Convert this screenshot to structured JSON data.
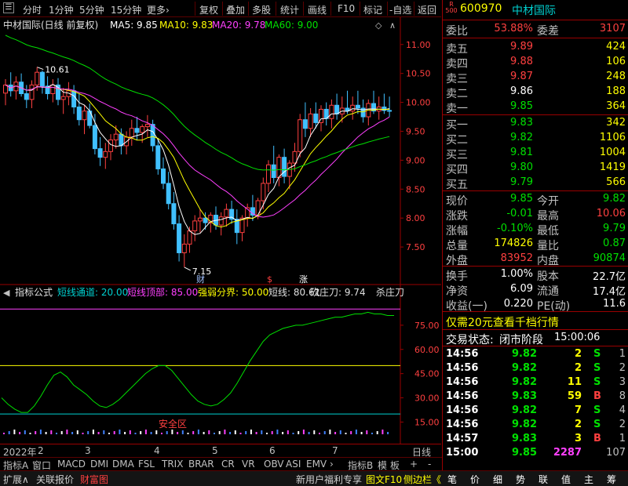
{
  "toolbar": {
    "items": [
      "分时",
      "1分钟",
      "5分钟",
      "15分钟",
      "更多›",
      "复权",
      "叠加",
      "多股",
      "统计",
      "画线",
      "F10",
      "标记",
      "-自选",
      "返回"
    ]
  },
  "chart": {
    "stock_title": "中材国际(日线 前复权)",
    "ma5": "MA5: 9.85",
    "ma10": "MA10: 9.83",
    "ma20": "MA20: 9.78",
    "ma60": "MA60: 9.00",
    "colors": {
      "up": "#ff4040",
      "down": "#40c0ff",
      "ma5": "#ffffff",
      "ma10": "#ffff00",
      "ma20": "#ff40ff",
      "ma60": "#00e000"
    },
    "y_ticks": [
      "11.00",
      "10.50",
      "10.00",
      "9.50",
      "9.00",
      "8.50",
      "8.00",
      "7.50"
    ],
    "high_label": "10.61",
    "low_label": "7.15",
    "markers": [
      "财",
      "$",
      "涨"
    ],
    "ind_bar": [
      "指标公式",
      "短线通道: 20.00",
      "短线顶部: 85.00",
      "强弱分界: 50.00",
      "短线: 80.61",
      "砍庄刀: 9.74",
      "杀庄刀"
    ],
    "ind_ticks": [
      "75.00",
      "60.00",
      "45.00",
      "30.00",
      "15.00"
    ],
    "safe_zone": "安全区",
    "date_labels": [
      "2022年",
      "2",
      "3",
      "4",
      "5",
      "6",
      "7"
    ],
    "period": "日线"
  },
  "chart_data": {
    "type": "candlestick",
    "ylim": [
      7.0,
      11.2
    ],
    "days": [
      [
        10.16,
        10.4,
        9.95,
        10.3
      ],
      [
        10.3,
        10.52,
        10.1,
        10.2
      ],
      [
        10.2,
        10.45,
        10.05,
        10.35
      ],
      [
        10.35,
        10.5,
        10.1,
        10.15
      ],
      [
        10.15,
        10.3,
        9.9,
        10.05
      ],
      [
        10.05,
        10.38,
        9.9,
        10.3
      ],
      [
        10.3,
        10.61,
        10.2,
        10.52
      ],
      [
        10.52,
        10.55,
        10.15,
        10.28
      ],
      [
        10.28,
        10.45,
        10.05,
        10.15
      ],
      [
        10.15,
        10.4,
        10.0,
        10.3
      ],
      [
        10.3,
        10.42,
        9.95,
        10.05
      ],
      [
        10.05,
        10.25,
        9.8,
        10.1
      ],
      [
        10.1,
        10.35,
        9.95,
        10.2
      ],
      [
        10.2,
        10.3,
        9.8,
        9.92
      ],
      [
        9.92,
        10.15,
        9.6,
        9.7
      ],
      [
        9.7,
        9.95,
        9.45,
        9.85
      ],
      [
        9.85,
        9.98,
        9.55,
        9.6
      ],
      [
        9.6,
        9.8,
        9.1,
        9.2
      ],
      [
        9.2,
        9.4,
        8.9,
        9.05
      ],
      [
        9.05,
        9.3,
        8.85,
        9.15
      ],
      [
        9.15,
        9.45,
        9.0,
        9.35
      ],
      [
        9.35,
        9.6,
        9.2,
        9.45
      ],
      [
        9.45,
        9.55,
        9.1,
        9.25
      ],
      [
        9.25,
        9.5,
        9.1,
        9.4
      ],
      [
        9.4,
        9.7,
        9.25,
        9.55
      ],
      [
        9.55,
        9.75,
        9.35,
        9.48
      ],
      [
        9.48,
        9.62,
        9.3,
        9.58
      ],
      [
        9.58,
        9.78,
        9.4,
        9.62
      ],
      [
        9.62,
        9.7,
        9.15,
        9.25
      ],
      [
        9.25,
        9.38,
        8.75,
        8.85
      ],
      [
        8.85,
        9.05,
        8.5,
        8.6
      ],
      [
        8.6,
        8.8,
        8.15,
        8.25
      ],
      [
        8.25,
        8.45,
        7.8,
        7.9
      ],
      [
        7.9,
        8.05,
        7.25,
        7.4
      ],
      [
        7.4,
        7.72,
        7.15,
        7.55
      ],
      [
        7.55,
        7.85,
        7.4,
        7.78
      ],
      [
        7.78,
        8.05,
        7.6,
        7.95
      ],
      [
        7.95,
        8.15,
        7.75,
        8.0
      ],
      [
        8.0,
        8.1,
        7.8,
        7.92
      ],
      [
        7.92,
        8.1,
        7.75,
        8.05
      ],
      [
        8.05,
        8.2,
        7.8,
        7.88
      ],
      [
        7.88,
        8.1,
        7.7,
        8.02
      ],
      [
        8.02,
        8.25,
        7.85,
        8.15
      ],
      [
        8.15,
        8.3,
        7.9,
        7.98
      ],
      [
        7.98,
        8.15,
        7.55,
        7.75
      ],
      [
        7.75,
        8.05,
        7.6,
        8.0
      ],
      [
        8.0,
        8.25,
        7.85,
        8.18
      ],
      [
        8.18,
        8.4,
        7.95,
        8.05
      ],
      [
        8.05,
        8.35,
        7.98,
        8.3
      ],
      [
        8.3,
        8.7,
        8.15,
        8.6
      ],
      [
        8.6,
        9.0,
        8.45,
        8.92
      ],
      [
        8.92,
        9.25,
        8.6,
        8.7
      ],
      [
        8.7,
        9.1,
        8.55,
        9.05
      ],
      [
        9.05,
        9.2,
        8.6,
        8.72
      ],
      [
        8.72,
        9.0,
        8.5,
        8.95
      ],
      [
        8.95,
        9.3,
        8.8,
        9.15
      ],
      [
        9.15,
        9.8,
        9.05,
        9.7
      ],
      [
        9.7,
        10.0,
        9.4,
        9.55
      ],
      [
        9.55,
        9.9,
        9.4,
        9.8
      ],
      [
        9.8,
        10.0,
        9.55,
        9.65
      ],
      [
        9.65,
        9.95,
        9.5,
        9.88
      ],
      [
        9.88,
        10.0,
        9.6,
        9.72
      ],
      [
        9.72,
        10.05,
        9.55,
        9.95
      ],
      [
        9.95,
        10.15,
        9.7,
        9.8
      ],
      [
        9.8,
        10.1,
        9.65,
        9.9
      ],
      [
        9.9,
        10.2,
        9.8,
        9.85
      ],
      [
        9.85,
        10.1,
        9.7,
        9.95
      ],
      [
        9.95,
        10.2,
        9.8,
        9.9
      ],
      [
        9.9,
        10.05,
        9.65,
        9.75
      ],
      [
        9.75,
        10.05,
        9.6,
        9.98
      ],
      [
        9.98,
        10.2,
        9.8,
        9.85
      ],
      [
        9.85,
        10.1,
        9.7,
        9.92
      ],
      [
        9.92,
        10.15,
        9.8,
        9.86
      ],
      [
        9.86,
        10.1,
        9.75,
        9.85
      ]
    ],
    "indicator_ylim": [
      5,
      90
    ],
    "indicator_short": [
      30,
      26,
      23,
      21,
      21,
      25,
      31,
      38,
      44,
      46,
      43,
      38,
      35,
      32,
      28,
      25,
      24,
      26,
      29,
      33,
      37,
      41,
      45,
      48,
      50,
      50,
      47,
      42,
      37,
      32,
      28,
      26,
      25,
      26,
      29,
      33,
      39,
      46,
      53,
      59,
      65,
      69,
      71,
      73,
      74,
      75,
      75,
      76,
      77,
      78,
      79,
      80,
      80,
      81,
      82,
      82,
      83,
      82,
      82,
      81,
      81
    ],
    "indicator_levels": {
      "top": 85,
      "mid": 50,
      "bottom": 20
    }
  },
  "quote": {
    "code": "600970",
    "name": "中材国际",
    "badge_r": "R",
    "badge_num": "500",
    "wei_bi_label": "委比",
    "wei_bi": "53.88%",
    "wei_cha_label": "委差",
    "wei_cha": "3107",
    "sell": [
      {
        "label": "卖五",
        "price": "9.89",
        "vol": "424"
      },
      {
        "label": "卖四",
        "price": "9.88",
        "vol": "106"
      },
      {
        "label": "卖三",
        "price": "9.87",
        "vol": "248"
      },
      {
        "label": "卖二",
        "price": "9.86",
        "vol": "188"
      },
      {
        "label": "卖一",
        "price": "9.85",
        "vol": "364"
      }
    ],
    "buy": [
      {
        "label": "买一",
        "price": "9.83",
        "vol": "342"
      },
      {
        "label": "买二",
        "price": "9.82",
        "vol": "1106"
      },
      {
        "label": "买三",
        "price": "9.81",
        "vol": "1004"
      },
      {
        "label": "买四",
        "price": "9.80",
        "vol": "1419"
      },
      {
        "label": "买五",
        "price": "9.79",
        "vol": "566"
      }
    ],
    "stats": [
      {
        "l1": "现价",
        "v1": "9.85",
        "l2": "今开",
        "v2": "9.82"
      },
      {
        "l1": "涨跌",
        "v1": "-0.01",
        "l2": "最高",
        "v2": "10.06"
      },
      {
        "l1": "涨幅",
        "v1": "-0.10%",
        "l2": "最低",
        "v2": "9.79"
      },
      {
        "l1": "总量",
        "v1": "174826",
        "l2": "量比",
        "v2": "0.87"
      },
      {
        "l1": "外盘",
        "v1": "83952",
        "l2": "内盘",
        "v2": "90874"
      }
    ],
    "fin": [
      {
        "l1": "换手",
        "v1": "1.00%",
        "l2": "股本",
        "v2": "22.7亿"
      },
      {
        "l1": "净资",
        "v1": "6.09",
        "l2": "流通",
        "v2": "17.4亿"
      },
      {
        "l1": "收益(一)",
        "v1": "0.220",
        "l2": "PE(动)",
        "v2": "11.6"
      }
    ],
    "promo": "仅需20元查看千档行情",
    "status_label": "交易状态:",
    "status_value": "闭市阶段",
    "status_time": "15:00:06",
    "ticks": [
      {
        "t": "14:56",
        "p": "9.82",
        "v": "2",
        "s": "S",
        "n": "1"
      },
      {
        "t": "14:56",
        "p": "9.82",
        "v": "2",
        "s": "S",
        "n": "2"
      },
      {
        "t": "14:56",
        "p": "9.82",
        "v": "11",
        "s": "S",
        "n": "3"
      },
      {
        "t": "14:56",
        "p": "9.83",
        "v": "59",
        "s": "B",
        "n": "8"
      },
      {
        "t": "14:56",
        "p": "9.82",
        "v": "7",
        "s": "S",
        "n": "4"
      },
      {
        "t": "14:56",
        "p": "9.82",
        "v": "2",
        "s": "S",
        "n": "2"
      },
      {
        "t": "14:57",
        "p": "9.83",
        "v": "3",
        "s": "B",
        "n": "1"
      },
      {
        "t": "15:00",
        "p": "9.85",
        "v": "2287",
        "s": "",
        "n": "107"
      }
    ]
  },
  "bottom_tabs": [
    "指标A",
    "窗口",
    "MACD",
    "DMI",
    "DMA",
    "FSL",
    "TRIX",
    "BRAR",
    "CR",
    "VR",
    "OBV",
    "ASI",
    "EMV",
    "›",
    "指标B",
    "模",
    "板",
    "+",
    "-"
  ],
  "status_bar": {
    "left": [
      "扩展∧",
      "关联报价",
      "财富图"
    ],
    "news": "新用户福利专享",
    "right": [
      "图文F10",
      "侧边栏《"
    ],
    "icons": [
      "笔",
      "价",
      "细",
      "势",
      "联",
      "值",
      "主",
      "筹"
    ]
  }
}
